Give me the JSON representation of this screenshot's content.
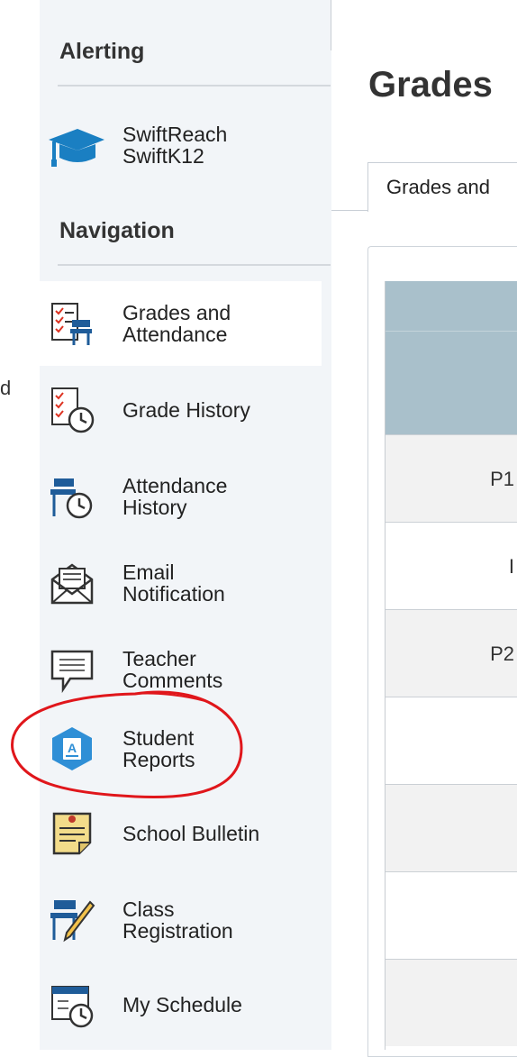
{
  "stray_text": "d",
  "sidebar": {
    "alerting_header": "Alerting",
    "swiftreach": {
      "line1": "SwiftReach",
      "line2": "SwiftK12"
    },
    "navigation_header": "Navigation",
    "items": [
      {
        "line1": "Grades and",
        "line2": "Attendance",
        "icon": "grades-attendance-icon",
        "active": true
      },
      {
        "line1": "Grade History",
        "line2": "",
        "icon": "grade-history-icon"
      },
      {
        "line1": "Attendance",
        "line2": "History",
        "icon": "attendance-history-icon"
      },
      {
        "line1": "Email",
        "line2": "Notification",
        "icon": "email-notification-icon"
      },
      {
        "line1": "Teacher",
        "line2": "Comments",
        "icon": "teacher-comments-icon"
      },
      {
        "line1": "Student",
        "line2": "Reports",
        "icon": "student-reports-icon"
      },
      {
        "line1": "School Bulletin",
        "line2": "",
        "icon": "school-bulletin-icon"
      },
      {
        "line1": "Class",
        "line2": "Registration",
        "icon": "class-registration-icon"
      },
      {
        "line1": "My Schedule",
        "line2": "",
        "icon": "my-schedule-icon"
      }
    ]
  },
  "main": {
    "title": "Grades",
    "tab_label": "Grades and",
    "rows": [
      "P1",
      "I",
      "P2",
      "",
      "",
      "",
      ""
    ]
  },
  "colors": {
    "sidebar_bg": "#f2f5f8",
    "table_header": "#a9c0cb",
    "annotation": "#e0161b",
    "collapse_button": "#1f5c99"
  }
}
